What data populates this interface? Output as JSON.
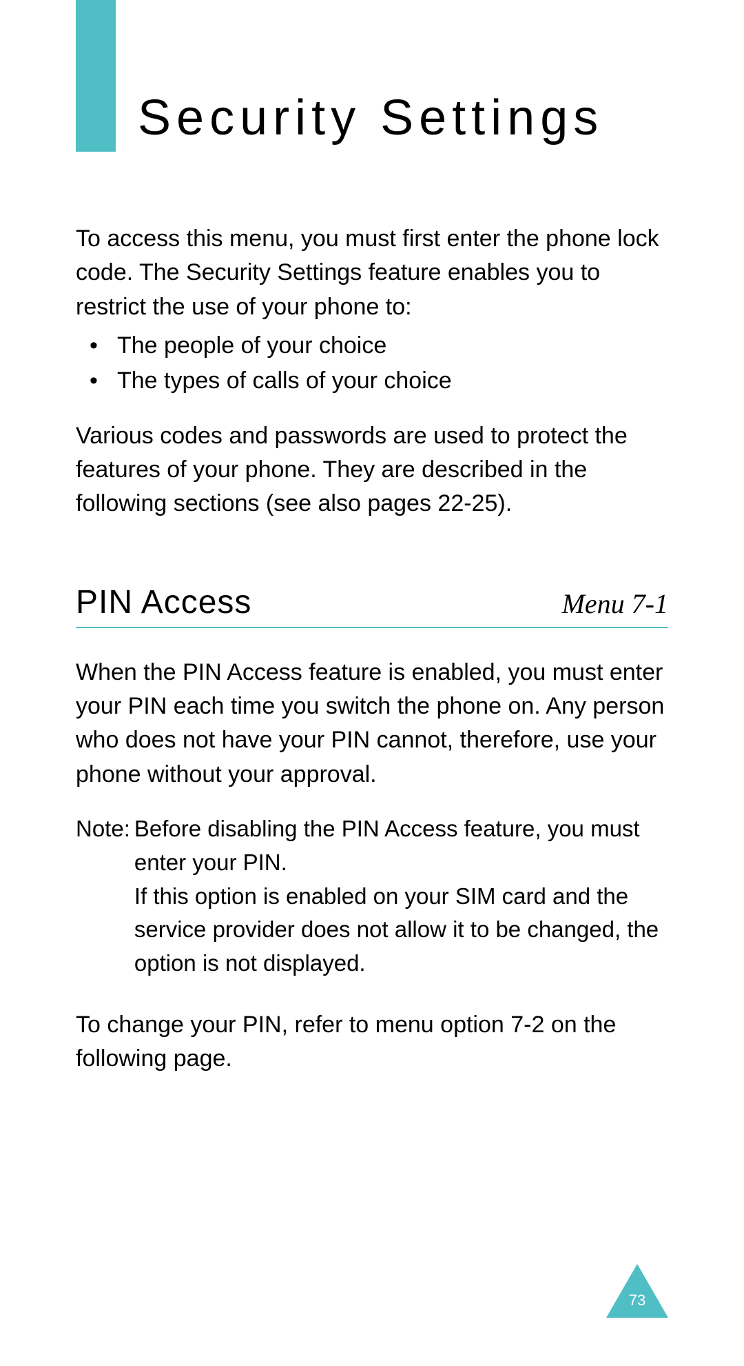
{
  "header": {
    "title": "Security Settings"
  },
  "intro": {
    "paragraph": "To access this menu, you must first enter the phone lock code. The Security Settings feature enables you to restrict the use of your phone to:",
    "bullets": [
      "The people of your choice",
      "The types of calls of your choice"
    ],
    "paragraph2": "Various codes and passwords are used to protect the features of your phone. They are described in the following sections (see also pages 22-25)."
  },
  "section": {
    "title": "PIN Access",
    "menu_ref": "Menu 7-1",
    "paragraph1": "When the PIN Access feature is enabled, you must enter your PIN each time you switch the phone on. Any person who does not have your PIN cannot, therefore, use your phone without your approval.",
    "note_label": "Note:",
    "note_text": "Before disabling the PIN Access feature, you must enter your PIN.\nIf this option is enabled on your SIM card and the service provider does not allow it to be changed, the option is not displayed.",
    "paragraph2": "To change your PIN, refer to menu option 7-2 on the following page."
  },
  "footer": {
    "page_number": "73"
  }
}
